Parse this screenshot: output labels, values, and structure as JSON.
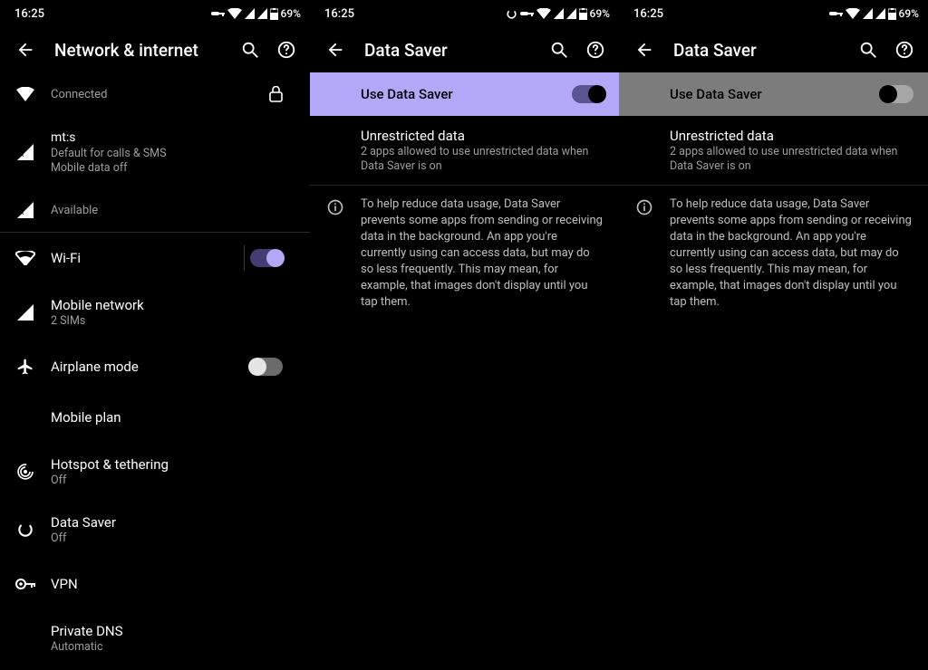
{
  "status": {
    "time": "16:25",
    "battery": "69%"
  },
  "screen1": {
    "title": "Network & internet",
    "wifi_connected": "Connected",
    "carrier": {
      "name": "mt:s",
      "line1": "Default for calls & SMS",
      "line2": "Mobile data off"
    },
    "sim_available": "Available",
    "wifi": "Wi-Fi",
    "mobile_network": {
      "title": "Mobile network",
      "sub": "2 SIMs"
    },
    "airplane": "Airplane mode",
    "mobile_plan": "Mobile plan",
    "hotspot": {
      "title": "Hotspot & tethering",
      "sub": "Off"
    },
    "data_saver": {
      "title": "Data Saver",
      "sub": "Off"
    },
    "vpn": "VPN",
    "private_dns": {
      "title": "Private DNS",
      "sub": "Automatic"
    }
  },
  "screen2": {
    "title": "Data Saver",
    "use_label": "Use Data Saver",
    "unrestricted": {
      "title": "Unrestricted data",
      "sub": "2 apps allowed to use unrestricted data when Data Saver is on"
    },
    "info": "To help reduce data usage, Data Saver prevents some apps from sending or receiving data in the background. An app you're currently using can access data, but may do so less frequently. This may mean, for example, that images don't display until you tap them."
  }
}
